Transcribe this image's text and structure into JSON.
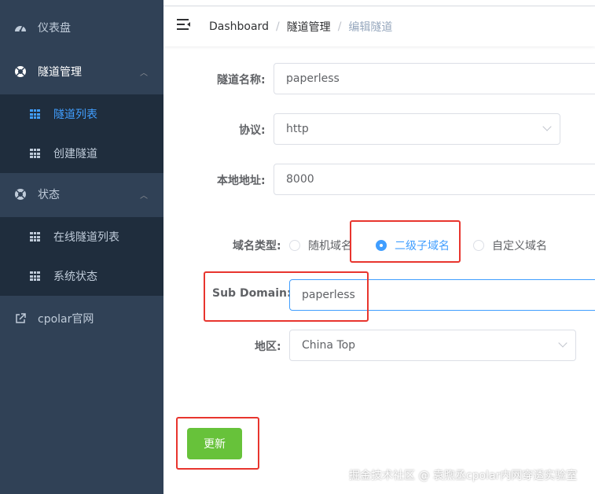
{
  "sidebar": {
    "dashboard": "仪表盘",
    "tunnel_mgmt": "隧道管理",
    "tunnel_list": "隧道列表",
    "create_tunnel": "创建隧道",
    "status": "状态",
    "online_tunnels": "在线隧道列表",
    "system_status": "系统状态",
    "cpolar_site": "cpolar官网",
    "active_color": "#409eff",
    "bg_color": "#304156"
  },
  "breadcrumb": {
    "home": "Dashboard",
    "section": "隧道管理",
    "current": "编辑隧道",
    "separator": "/"
  },
  "form": {
    "tunnel_name_label": "隧道名称:",
    "tunnel_name_value": "paperless",
    "protocol_label": "协议:",
    "protocol_value": "http",
    "local_addr_label": "本地地址:",
    "local_addr_value": "8000",
    "domain_type_label": "域名类型:",
    "domain_type_options": [
      "随机域名",
      "二级子域名",
      "自定义域名"
    ],
    "domain_type_selected": "二级子域名",
    "subdomain_label": "Sub Domain:",
    "subdomain_value": "paperless",
    "region_label": "地区:",
    "region_value": "China Top",
    "update_button": "更新"
  },
  "watermark": "掘金技术社区 @ 袁煦丞cpolar内网穿透实验室"
}
